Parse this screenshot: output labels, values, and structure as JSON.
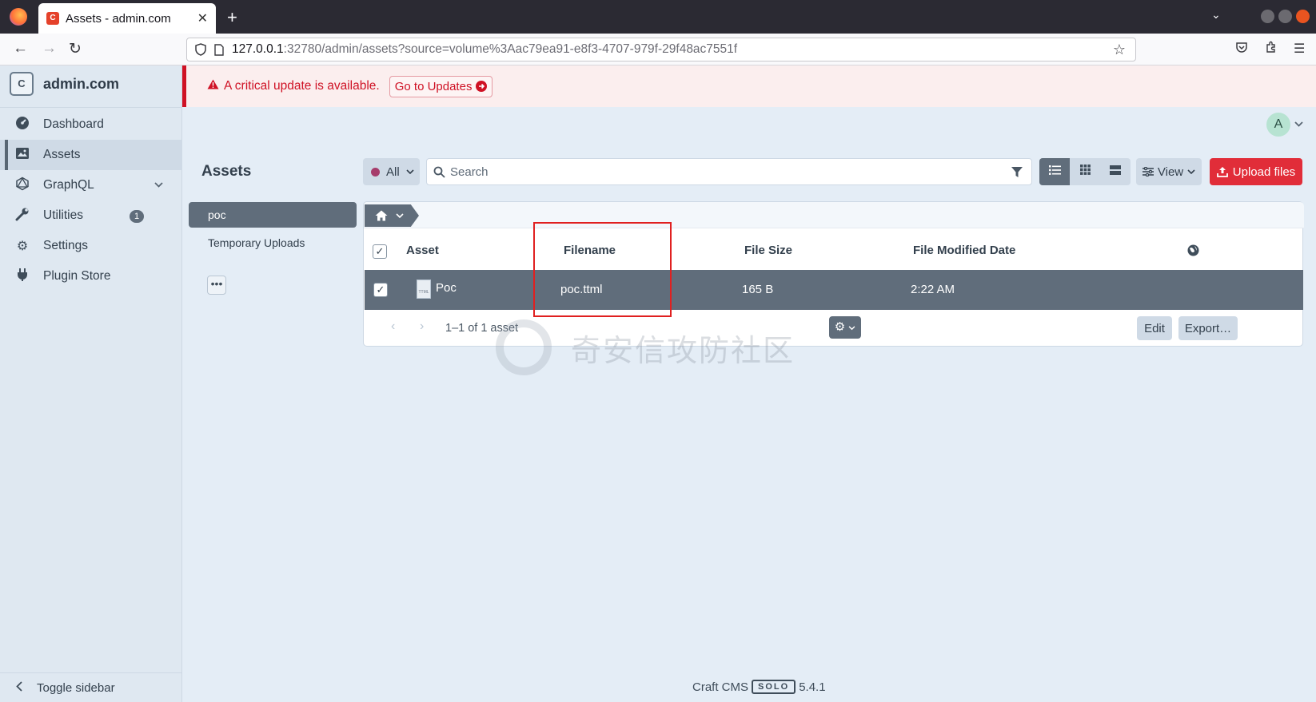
{
  "browser": {
    "tab_title": "Assets - admin.com",
    "tab_favicon_letter": "C",
    "url_host": "127.0.0.1",
    "url_rest": ":32780/admin/assets?source=volume%3Aac79ea91-e8f3-4707-979f-29f48ac7551f"
  },
  "sidebar": {
    "site_icon_letter": "C",
    "site_name": "admin.com",
    "items": [
      {
        "label": "Dashboard",
        "icon": "gauge-icon"
      },
      {
        "label": "Assets",
        "icon": "image-icon"
      },
      {
        "label": "GraphQL",
        "icon": "graphql-icon"
      },
      {
        "label": "Utilities",
        "icon": "wrench-icon",
        "badge": "1"
      },
      {
        "label": "Settings",
        "icon": "gear-icon"
      },
      {
        "label": "Plugin Store",
        "icon": "plug-icon"
      }
    ],
    "toggle_label": "Toggle sidebar"
  },
  "alert": {
    "message": "A critical update is available.",
    "button": "Go to Updates"
  },
  "user": {
    "avatar_letter": "A"
  },
  "page": {
    "title": "Assets"
  },
  "sources": [
    {
      "label": "poc",
      "selected": true
    },
    {
      "label": "Temporary Uploads",
      "selected": false
    }
  ],
  "toolbar": {
    "site_filter": "All",
    "search_placeholder": "Search",
    "view_label": "View",
    "upload_label": "Upload files"
  },
  "table": {
    "headers": {
      "asset": "Asset",
      "filename": "Filename",
      "size": "File Size",
      "modified": "File Modified Date"
    },
    "rows": [
      {
        "title": "Poc",
        "filename": "poc.ttml",
        "size": "165 B",
        "modified": "2:22 AM",
        "checked": true
      }
    ],
    "file_icon_ext": "TTML",
    "count_text": "1–1 of 1 asset",
    "edit_label": "Edit",
    "export_label": "Export…"
  },
  "watermark": "奇安信攻防社区",
  "footer": {
    "product": "Craft CMS",
    "edition": "SOLO",
    "version": "5.4.1"
  },
  "colors": {
    "danger": "#e12d39",
    "alert_text": "#cf1124",
    "selected_row": "#606d7b",
    "highlight_box": "#e02020"
  }
}
